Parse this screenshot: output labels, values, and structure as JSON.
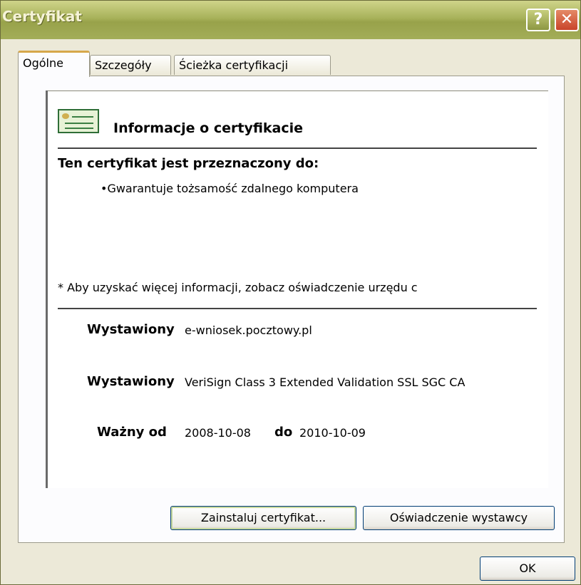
{
  "window": {
    "title": "Certyfikat",
    "help_glyph": "?",
    "close_glyph": "✕"
  },
  "tabs": [
    {
      "label": "Ogólne",
      "active": true
    },
    {
      "label": "Szczegóły",
      "active": false
    },
    {
      "label": "Ścieżka certyfikacji",
      "active": false
    }
  ],
  "info": {
    "title": "Informacje o certyfikacie",
    "purpose_heading": "Ten certyfikat jest przeznaczony do:",
    "purpose_item": "•Gwarantuje tożsamość zdalnego komputera",
    "note": "* Aby uzyskać więcej informacji, zobacz oświadczenie urzędu c",
    "issued_to_label": "Wystawiony",
    "issued_to_value": "e-wniosek.pocztowy.pl",
    "issued_by_label": "Wystawiony",
    "issued_by_value": "VeriSign Class 3 Extended Validation SSL SGC CA",
    "valid_from_label": "Ważny od",
    "valid_from_value": "2008-10-08",
    "valid_to_label": "do",
    "valid_to_value": "2010-10-09"
  },
  "buttons": {
    "install": "Zainstaluj certyfikat...",
    "statement": "Oświadczenie wystawcy",
    "ok": "OK"
  },
  "colors": {
    "titlebar": "#a8b25a",
    "face": "#ece9d8",
    "tab_accent": "#d6a74b"
  },
  "icons": {
    "certificate": "certificate-icon",
    "help": "help-icon",
    "close": "close-icon"
  }
}
